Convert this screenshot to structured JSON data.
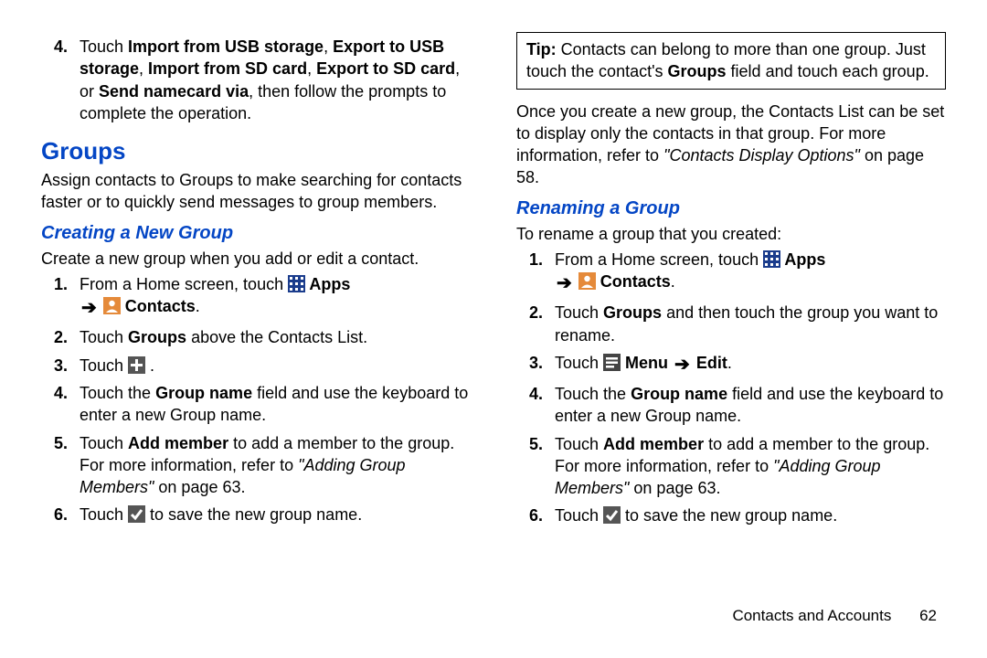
{
  "left": {
    "step4_prefix": "Touch ",
    "step4_b1": "Import from USB storage",
    "step4_c1": ", ",
    "step4_b2": "Export to USB storage",
    "step4_c2": ", ",
    "step4_b3": "Import from SD card",
    "step4_c3": ", ",
    "step4_b4": "Export to SD card",
    "step4_c4": ", or ",
    "step4_b5": "Send namecard via",
    "step4_suffix": ", then follow the prompts to complete the operation.",
    "h2": "Groups",
    "intro": "Assign contacts to Groups to make searching for contacts faster or to quickly send messages to group members.",
    "h3": "Creating a New Group",
    "p_create": "Create a new group when you add or edit a contact.",
    "s1_prefix": "From a Home screen, touch ",
    "apps_label": " Apps",
    "arrow": "➔",
    "contacts_label": " Contacts",
    "s1_period": ".",
    "s2_a": "Touch ",
    "s2_b": "Groups",
    "s2_c": " above the Contacts List.",
    "s3_a": "Touch ",
    "s3_period": " .",
    "s4_a": "Touch the ",
    "s4_b": "Group name",
    "s4_c": " field and use the keyboard to enter a new Group name.",
    "s5_a": "Touch ",
    "s5_b": "Add member",
    "s5_c": " to add a member to the group. For more information, refer to ",
    "s5_i": "\"Adding Group Members\"",
    "s5_d": " on page 63.",
    "s6_a": "Touch ",
    "s6_b": " to save the new group name."
  },
  "right": {
    "tip_b": "Tip:",
    "tip_a": " Contacts can belong to more than one group. Just touch the contact's ",
    "tip_b2": "Groups",
    "tip_c": " field and touch each group.",
    "para_a": "Once you create a new group, the Contacts List can be set to display only the contacts in that group. For more information, refer to ",
    "para_i": "\"Contacts Display Options\"",
    "para_b": " on page 58.",
    "h3": "Renaming a Group",
    "p_rename": "To rename a group that you created:",
    "s1_prefix": "From a Home screen, touch ",
    "apps_label": " Apps",
    "arrow": "➔",
    "contacts_label": " Contacts",
    "s1_period": ".",
    "s2_a": "Touch ",
    "s2_b": "Groups",
    "s2_c": " and then touch the group you want to rename.",
    "s3_a": "Touch ",
    "menu_label": " Menu ",
    "arrow3": "➔",
    "edit_label": " Edit",
    "s3_period": ".",
    "s4_a": "Touch the ",
    "s4_b": "Group name",
    "s4_c": " field and use the keyboard to enter a new Group name.",
    "s5_a": "Touch ",
    "s5_b": "Add member",
    "s5_c": " to add a member to the group. For more information, refer to ",
    "s5_i": "\"Adding Group Members\"",
    "s5_d": " on page 63.",
    "s6_a": "Touch ",
    "s6_b": " to save the new group name."
  },
  "footer": {
    "section": "Contacts and Accounts",
    "page": "62"
  }
}
